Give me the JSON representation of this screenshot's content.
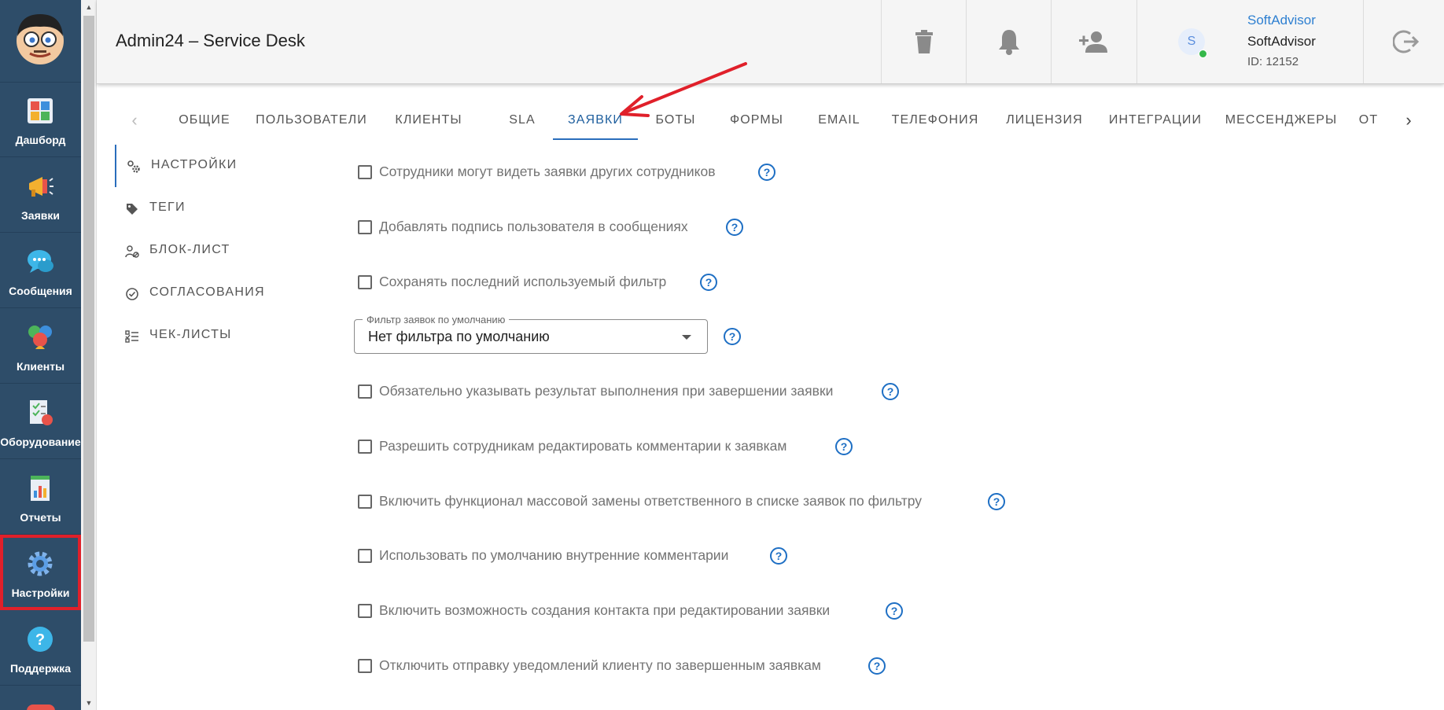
{
  "header": {
    "title": "Admin24 – Service Desk",
    "user": {
      "link": "SoftAdvisor",
      "name": "SoftAdvisor",
      "id": "ID: 12152",
      "avatar_letter": "S"
    }
  },
  "nav": {
    "items": [
      {
        "label": "Дашборд",
        "icon": "dashboard-icon"
      },
      {
        "label": "Заявки",
        "icon": "megaphone-icon"
      },
      {
        "label": "Сообщения",
        "icon": "chat-bubble-icon"
      },
      {
        "label": "Клиенты",
        "icon": "clients-icon"
      },
      {
        "label": "Оборудование",
        "icon": "equipment-icon"
      },
      {
        "label": "Отчеты",
        "icon": "report-icon"
      },
      {
        "label": "Настройки",
        "icon": "gear-icon",
        "active": true
      },
      {
        "label": "Поддержка",
        "icon": "question-icon"
      }
    ]
  },
  "tabs": {
    "items": [
      "ОБЩИЕ",
      "ПОЛЬЗОВАТЕЛИ",
      "КЛИЕНТЫ",
      "SLA",
      "ЗАЯВКИ",
      "БОТЫ",
      "ФОРМЫ",
      "EMAIL",
      "ТЕЛЕФОНИЯ",
      "ЛИЦЕНЗИЯ",
      "ИНТЕГРАЦИИ",
      "МЕССЕНДЖЕРЫ",
      "ОТ"
    ],
    "active": "ЗАЯВКИ"
  },
  "submenu": {
    "items": [
      "НАСТРОЙКИ",
      "ТЕГИ",
      "БЛОК-ЛИСТ",
      "СОГЛАСОВАНИЯ",
      "ЧЕК-ЛИСТЫ"
    ],
    "active": "НАСТРОЙКИ"
  },
  "settings": {
    "options": [
      {
        "label": "Сотрудники могут видеть заявки других сотрудников",
        "checked": false
      },
      {
        "label": "Добавлять подпись пользователя в сообщениях",
        "checked": false
      },
      {
        "label": "Сохранять последний используемый фильтр",
        "checked": false
      },
      {
        "label": "Обязательно указывать результат выполнения при завершении заявки",
        "checked": false
      },
      {
        "label": "Разрешить сотрудникам редактировать комментарии к заявкам",
        "checked": false
      },
      {
        "label": "Включить функционал массовой замены ответственного в списке заявок по фильтру",
        "checked": false
      },
      {
        "label": "Использовать по умолчанию внутренние комментарии",
        "checked": false
      },
      {
        "label": "Включить возможность создания контакта при редактировании заявки",
        "checked": false
      },
      {
        "label": "Отключить отправку уведомлений клиенту по завершенным заявкам",
        "checked": false
      }
    ],
    "filter": {
      "label": "Фильтр заявок по умолчанию",
      "value": "Нет фильтра по умолчанию"
    }
  },
  "colors": {
    "nav_bg": "#2e4d69",
    "accent": "#2a6ebc",
    "help": "#1e6fc4",
    "highlight": "#e0202a"
  }
}
